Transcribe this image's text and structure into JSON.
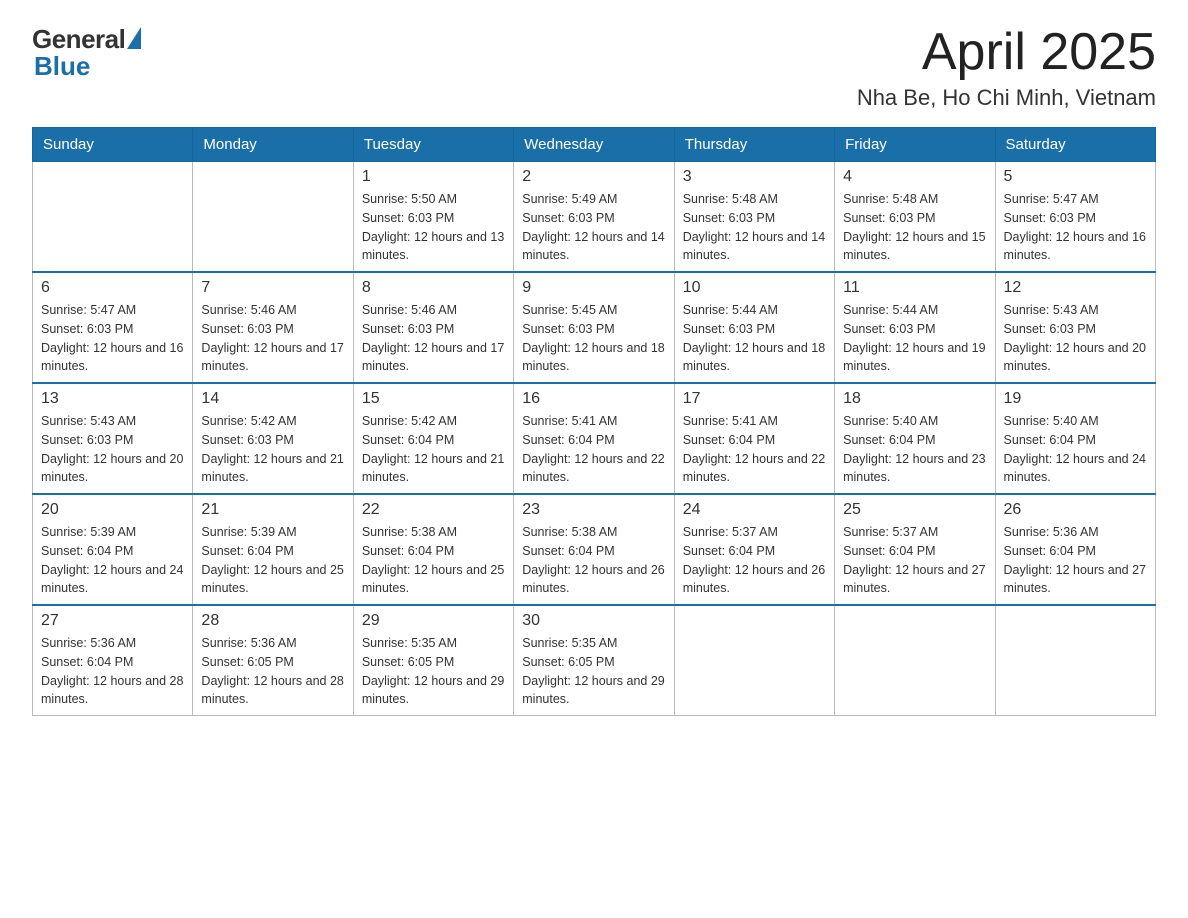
{
  "header": {
    "logo_general": "General",
    "logo_blue": "Blue",
    "month_title": "April 2025",
    "location": "Nha Be, Ho Chi Minh, Vietnam"
  },
  "weekdays": [
    "Sunday",
    "Monday",
    "Tuesday",
    "Wednesday",
    "Thursday",
    "Friday",
    "Saturday"
  ],
  "weeks": [
    [
      {
        "day": "",
        "sunrise": "",
        "sunset": "",
        "daylight": ""
      },
      {
        "day": "",
        "sunrise": "",
        "sunset": "",
        "daylight": ""
      },
      {
        "day": "1",
        "sunrise": "Sunrise: 5:50 AM",
        "sunset": "Sunset: 6:03 PM",
        "daylight": "Daylight: 12 hours and 13 minutes."
      },
      {
        "day": "2",
        "sunrise": "Sunrise: 5:49 AM",
        "sunset": "Sunset: 6:03 PM",
        "daylight": "Daylight: 12 hours and 14 minutes."
      },
      {
        "day": "3",
        "sunrise": "Sunrise: 5:48 AM",
        "sunset": "Sunset: 6:03 PM",
        "daylight": "Daylight: 12 hours and 14 minutes."
      },
      {
        "day": "4",
        "sunrise": "Sunrise: 5:48 AM",
        "sunset": "Sunset: 6:03 PM",
        "daylight": "Daylight: 12 hours and 15 minutes."
      },
      {
        "day": "5",
        "sunrise": "Sunrise: 5:47 AM",
        "sunset": "Sunset: 6:03 PM",
        "daylight": "Daylight: 12 hours and 16 minutes."
      }
    ],
    [
      {
        "day": "6",
        "sunrise": "Sunrise: 5:47 AM",
        "sunset": "Sunset: 6:03 PM",
        "daylight": "Daylight: 12 hours and 16 minutes."
      },
      {
        "day": "7",
        "sunrise": "Sunrise: 5:46 AM",
        "sunset": "Sunset: 6:03 PM",
        "daylight": "Daylight: 12 hours and 17 minutes."
      },
      {
        "day": "8",
        "sunrise": "Sunrise: 5:46 AM",
        "sunset": "Sunset: 6:03 PM",
        "daylight": "Daylight: 12 hours and 17 minutes."
      },
      {
        "day": "9",
        "sunrise": "Sunrise: 5:45 AM",
        "sunset": "Sunset: 6:03 PM",
        "daylight": "Daylight: 12 hours and 18 minutes."
      },
      {
        "day": "10",
        "sunrise": "Sunrise: 5:44 AM",
        "sunset": "Sunset: 6:03 PM",
        "daylight": "Daylight: 12 hours and 18 minutes."
      },
      {
        "day": "11",
        "sunrise": "Sunrise: 5:44 AM",
        "sunset": "Sunset: 6:03 PM",
        "daylight": "Daylight: 12 hours and 19 minutes."
      },
      {
        "day": "12",
        "sunrise": "Sunrise: 5:43 AM",
        "sunset": "Sunset: 6:03 PM",
        "daylight": "Daylight: 12 hours and 20 minutes."
      }
    ],
    [
      {
        "day": "13",
        "sunrise": "Sunrise: 5:43 AM",
        "sunset": "Sunset: 6:03 PM",
        "daylight": "Daylight: 12 hours and 20 minutes."
      },
      {
        "day": "14",
        "sunrise": "Sunrise: 5:42 AM",
        "sunset": "Sunset: 6:03 PM",
        "daylight": "Daylight: 12 hours and 21 minutes."
      },
      {
        "day": "15",
        "sunrise": "Sunrise: 5:42 AM",
        "sunset": "Sunset: 6:04 PM",
        "daylight": "Daylight: 12 hours and 21 minutes."
      },
      {
        "day": "16",
        "sunrise": "Sunrise: 5:41 AM",
        "sunset": "Sunset: 6:04 PM",
        "daylight": "Daylight: 12 hours and 22 minutes."
      },
      {
        "day": "17",
        "sunrise": "Sunrise: 5:41 AM",
        "sunset": "Sunset: 6:04 PM",
        "daylight": "Daylight: 12 hours and 22 minutes."
      },
      {
        "day": "18",
        "sunrise": "Sunrise: 5:40 AM",
        "sunset": "Sunset: 6:04 PM",
        "daylight": "Daylight: 12 hours and 23 minutes."
      },
      {
        "day": "19",
        "sunrise": "Sunrise: 5:40 AM",
        "sunset": "Sunset: 6:04 PM",
        "daylight": "Daylight: 12 hours and 24 minutes."
      }
    ],
    [
      {
        "day": "20",
        "sunrise": "Sunrise: 5:39 AM",
        "sunset": "Sunset: 6:04 PM",
        "daylight": "Daylight: 12 hours and 24 minutes."
      },
      {
        "day": "21",
        "sunrise": "Sunrise: 5:39 AM",
        "sunset": "Sunset: 6:04 PM",
        "daylight": "Daylight: 12 hours and 25 minutes."
      },
      {
        "day": "22",
        "sunrise": "Sunrise: 5:38 AM",
        "sunset": "Sunset: 6:04 PM",
        "daylight": "Daylight: 12 hours and 25 minutes."
      },
      {
        "day": "23",
        "sunrise": "Sunrise: 5:38 AM",
        "sunset": "Sunset: 6:04 PM",
        "daylight": "Daylight: 12 hours and 26 minutes."
      },
      {
        "day": "24",
        "sunrise": "Sunrise: 5:37 AM",
        "sunset": "Sunset: 6:04 PM",
        "daylight": "Daylight: 12 hours and 26 minutes."
      },
      {
        "day": "25",
        "sunrise": "Sunrise: 5:37 AM",
        "sunset": "Sunset: 6:04 PM",
        "daylight": "Daylight: 12 hours and 27 minutes."
      },
      {
        "day": "26",
        "sunrise": "Sunrise: 5:36 AM",
        "sunset": "Sunset: 6:04 PM",
        "daylight": "Daylight: 12 hours and 27 minutes."
      }
    ],
    [
      {
        "day": "27",
        "sunrise": "Sunrise: 5:36 AM",
        "sunset": "Sunset: 6:04 PM",
        "daylight": "Daylight: 12 hours and 28 minutes."
      },
      {
        "day": "28",
        "sunrise": "Sunrise: 5:36 AM",
        "sunset": "Sunset: 6:05 PM",
        "daylight": "Daylight: 12 hours and 28 minutes."
      },
      {
        "day": "29",
        "sunrise": "Sunrise: 5:35 AM",
        "sunset": "Sunset: 6:05 PM",
        "daylight": "Daylight: 12 hours and 29 minutes."
      },
      {
        "day": "30",
        "sunrise": "Sunrise: 5:35 AM",
        "sunset": "Sunset: 6:05 PM",
        "daylight": "Daylight: 12 hours and 29 minutes."
      },
      {
        "day": "",
        "sunrise": "",
        "sunset": "",
        "daylight": ""
      },
      {
        "day": "",
        "sunrise": "",
        "sunset": "",
        "daylight": ""
      },
      {
        "day": "",
        "sunrise": "",
        "sunset": "",
        "daylight": ""
      }
    ]
  ]
}
